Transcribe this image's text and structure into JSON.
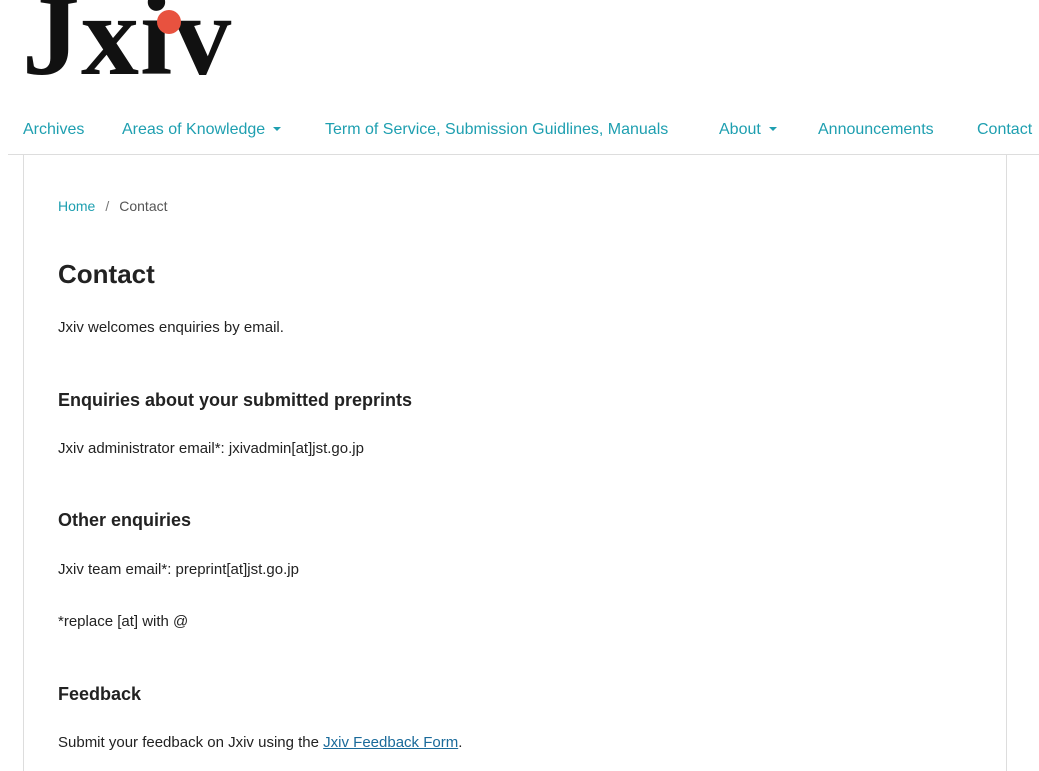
{
  "logo": {
    "text": "Jxiv",
    "dot_color": "#e8523f"
  },
  "nav": {
    "items": [
      {
        "label": "Archives",
        "dropdown": false
      },
      {
        "label": "Areas of Knowledge",
        "dropdown": true
      },
      {
        "label": "Term of Service, Submission Guidlines, Manuals",
        "dropdown": false
      },
      {
        "label": "About",
        "dropdown": true
      },
      {
        "label": "Announcements",
        "dropdown": false
      },
      {
        "label": "Contact",
        "dropdown": false
      }
    ]
  },
  "breadcrumb": {
    "home": "Home",
    "separator": "/",
    "current": "Contact"
  },
  "main": {
    "title": "Contact",
    "intro": "Jxiv welcomes enquiries by email.",
    "sections": [
      {
        "heading": "Enquiries about your submitted preprints",
        "text": "Jxiv administrator email*: jxivadmin[at]jst.go.jp"
      },
      {
        "heading": "Other enquiries",
        "text": "Jxiv team email*: preprint[at]jst.go.jp",
        "note": "*replace [at] with @"
      },
      {
        "heading": "Feedback",
        "text_before": "Submit your feedback on Jxiv using the ",
        "link_label": "Jxiv Feedback Form",
        "text_after": "."
      }
    ]
  },
  "colors": {
    "accent": "#1e9fb0",
    "link": "#1a6a9a",
    "text": "#222222"
  }
}
